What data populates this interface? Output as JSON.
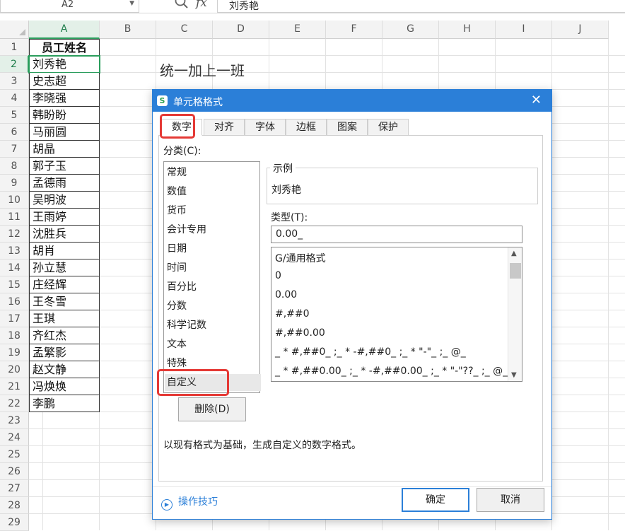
{
  "formula_bar": {
    "name_box": "A2",
    "fx_label": "fx",
    "content": "刘秀艳"
  },
  "columns": [
    "A",
    "B",
    "C",
    "D",
    "E",
    "F",
    "G",
    "H",
    "I",
    "J"
  ],
  "rows": [
    "1",
    "2",
    "3",
    "4",
    "5",
    "6",
    "7",
    "8",
    "9",
    "10",
    "11",
    "12",
    "13",
    "14",
    "15",
    "16",
    "17",
    "18",
    "19",
    "20",
    "21",
    "22",
    "23",
    "24",
    "25",
    "26",
    "27",
    "28",
    "29"
  ],
  "column_a": {
    "header": "员工姓名",
    "names": [
      "刘秀艳",
      "史志超",
      "李晓强",
      "韩盼盼",
      "马丽圆",
      "胡晶",
      "郭子玉",
      "孟德雨",
      "吴明波",
      "王雨婷",
      "沈胜兵",
      "胡肖",
      "孙立慧",
      "庄经辉",
      "王冬雪",
      "王琪",
      "齐红杰",
      "孟繁影",
      "赵文静",
      "冯焕焕",
      "李鹏"
    ]
  },
  "note_c2": "统一加上一班",
  "dialog": {
    "title": "单元格格式",
    "close": "✕",
    "tabs": [
      "数字",
      "对齐",
      "字体",
      "边框",
      "图案",
      "保护"
    ],
    "category_label": "分类(C):",
    "categories": [
      "常规",
      "数值",
      "货币",
      "会计专用",
      "日期",
      "时间",
      "百分比",
      "分数",
      "科学记数",
      "文本",
      "特殊",
      "自定义"
    ],
    "sample_legend": "示例",
    "sample_value": "刘秀艳",
    "type_label": "类型(T):",
    "type_value": "0.00_",
    "type_list": [
      "G/通用格式",
      "0",
      "0.00",
      "#,##0",
      "#,##0.00",
      "_ * #,##0_ ;_ * -#,##0_ ;_ * \"-\"_ ;_ @_",
      "_ * #,##0.00_ ;_ * -#,##0.00_ ;_ * \"-\"??_ ;_ @_"
    ],
    "delete_button": "删除(D)",
    "description": "以现有格式为基础，生成自定义的数字格式。",
    "tips_link": "操作技巧",
    "ok_button": "确定",
    "cancel_button": "取消",
    "highlight_color": "#e53935",
    "accent_color": "#2b7fd8"
  }
}
